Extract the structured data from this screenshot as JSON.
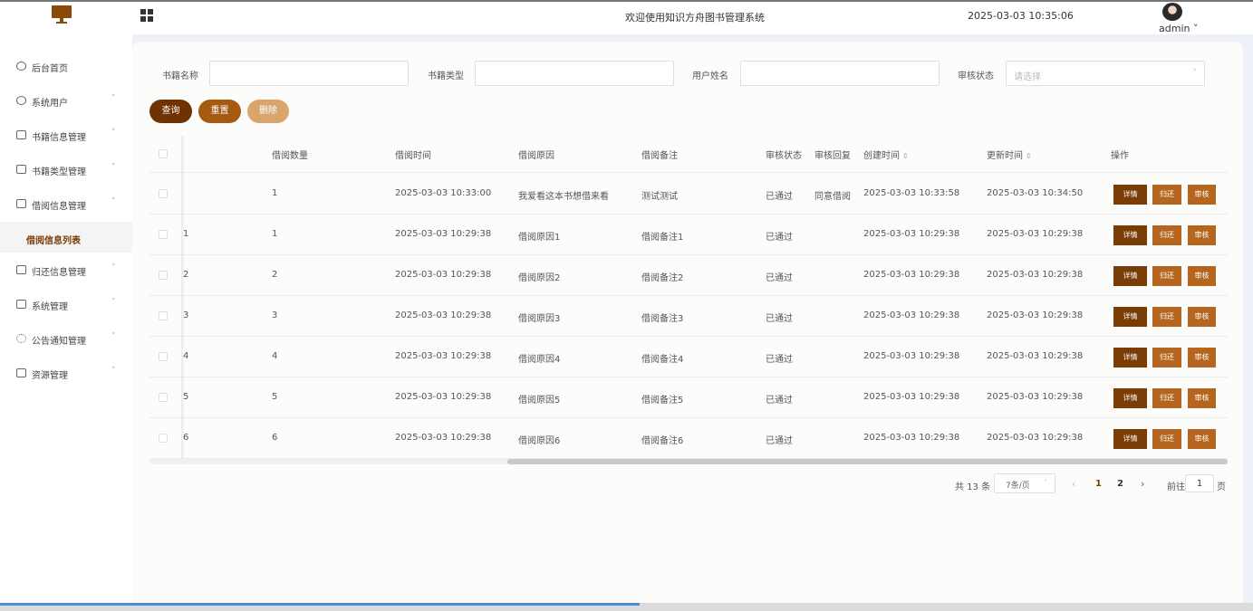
{
  "header": {
    "title": "欢迎使用知识方舟图书管理系统",
    "time": "2025-03-03 10:35:06",
    "user": "admin",
    "user_chevron": "˅"
  },
  "sidebar": {
    "items": [
      {
        "label": "后台首页",
        "icon": "clock-icon",
        "chevron": ""
      },
      {
        "label": "系统用户",
        "icon": "user-icon",
        "chevron": "˅"
      },
      {
        "label": "书籍信息管理",
        "icon": "doc-icon",
        "chevron": "˅"
      },
      {
        "label": "书籍类型管理",
        "icon": "doc-icon",
        "chevron": "˅"
      },
      {
        "label": "借阅信息管理",
        "icon": "doc-icon",
        "chevron": "˄"
      },
      {
        "label": "归还信息管理",
        "icon": "doc-icon",
        "chevron": "˅"
      },
      {
        "label": "系统管理",
        "icon": "folder-icon",
        "chevron": "˅"
      },
      {
        "label": "公告通知管理",
        "icon": "loading-icon",
        "chevron": "˅"
      },
      {
        "label": "资源管理",
        "icon": "printer-icon",
        "chevron": "˅"
      }
    ],
    "active_sub": "借阅信息列表"
  },
  "search": {
    "book_name_label": "书籍名称",
    "book_name_value": "",
    "book_type_label": "书籍类型",
    "book_type_value": "",
    "user_name_label": "用户姓名",
    "user_name_value": "",
    "audit_status_label": "审核状态",
    "audit_status_placeholder": "请选择",
    "select_chevron": "˅"
  },
  "buttons": {
    "query": "查询",
    "reset": "重置",
    "delete": "删除"
  },
  "table": {
    "columns": {
      "qty": "借阅数量",
      "time": "借阅时间",
      "reason": "借阅原因",
      "remark": "借阅备注",
      "status": "审核状态",
      "reply": "审核回复",
      "created": "创建时间",
      "updated": "更新时间",
      "actions": "操作"
    },
    "sort_glyph": "⇕",
    "actions": {
      "detail": "详情",
      "return": "归还",
      "audit": "审核"
    },
    "rows": [
      {
        "idx": "",
        "qty": "1",
        "time": "2025-03-03 10:33:00",
        "reason": "我爱看这本书想借来看",
        "remark": "测试测试",
        "status": "已通过",
        "reply": "同意借阅",
        "created": "2025-03-03 10:33:58",
        "updated": "2025-03-03 10:34:50"
      },
      {
        "idx": "1",
        "qty": "1",
        "time": "2025-03-03 10:29:38",
        "reason": "借阅原因1",
        "remark": "借阅备注1",
        "status": "已通过",
        "reply": "",
        "created": "2025-03-03 10:29:38",
        "updated": "2025-03-03 10:29:38"
      },
      {
        "idx": "2",
        "qty": "2",
        "time": "2025-03-03 10:29:38",
        "reason": "借阅原因2",
        "remark": "借阅备注2",
        "status": "已通过",
        "reply": "",
        "created": "2025-03-03 10:29:38",
        "updated": "2025-03-03 10:29:38"
      },
      {
        "idx": "3",
        "qty": "3",
        "time": "2025-03-03 10:29:38",
        "reason": "借阅原因3",
        "remark": "借阅备注3",
        "status": "已通过",
        "reply": "",
        "created": "2025-03-03 10:29:38",
        "updated": "2025-03-03 10:29:38"
      },
      {
        "idx": "4",
        "qty": "4",
        "time": "2025-03-03 10:29:38",
        "reason": "借阅原因4",
        "remark": "借阅备注4",
        "status": "已通过",
        "reply": "",
        "created": "2025-03-03 10:29:38",
        "updated": "2025-03-03 10:29:38"
      },
      {
        "idx": "5",
        "qty": "5",
        "time": "2025-03-03 10:29:38",
        "reason": "借阅原因5",
        "remark": "借阅备注5",
        "status": "已通过",
        "reply": "",
        "created": "2025-03-03 10:29:38",
        "updated": "2025-03-03 10:29:38"
      },
      {
        "idx": "6",
        "qty": "6",
        "time": "2025-03-03 10:29:38",
        "reason": "借阅原因6",
        "remark": "借阅备注6",
        "status": "已通过",
        "reply": "",
        "created": "2025-03-03 10:29:38",
        "updated": "2025-03-03 10:29:38"
      }
    ]
  },
  "pagination": {
    "total": "共 13 条",
    "page_size": "7条/页",
    "size_chevron": "˅",
    "prev": "‹",
    "next": "›",
    "pages": [
      "1",
      "2"
    ],
    "current_page": "1",
    "goto_label": "前往",
    "goto_value": "1",
    "goto_suffix": "页"
  },
  "colors": {
    "primary": "#6e3203",
    "accent": "#a55a10",
    "light": "#d9a56c"
  }
}
